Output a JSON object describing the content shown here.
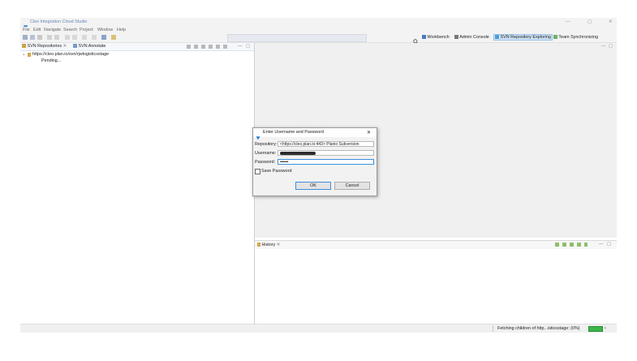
{
  "app": {
    "title": "Cleo Integration Cloud Studio",
    "window_controls": {
      "minimize": "—",
      "maximize": "▢",
      "close": "✕"
    }
  },
  "menu": [
    "File",
    "Edit",
    "Navigate",
    "Search",
    "Project",
    "Window",
    "Help"
  ],
  "toolbar": {
    "perspectives": {
      "workbench": "Workbench",
      "admin_console": "Admin Console",
      "svn_exploring": "SVN Repository Exploring",
      "team_sync": "Team Synchronizing"
    }
  },
  "left_panel": {
    "tabs": [
      {
        "label": "SVN Repositories",
        "close": "✕"
      },
      {
        "label": "SVN Annotate"
      }
    ],
    "tree": {
      "root": "https://cleo.plan.io/svn/rjwlogisticsstage",
      "child": "Pending..."
    }
  },
  "history_panel": {
    "tab": "History",
    "close": "✕"
  },
  "status": {
    "text": "Fetching children of http...isticsstage: (0%)",
    "progress": 0.0
  },
  "dialog": {
    "title": "Enter Username and Password",
    "close": "✕",
    "repository_label": "Repository:",
    "repository_value": "<https://cleo.plan.io:443> Planio Subversion",
    "username_label": "Username:",
    "password_label": "Password:",
    "password_value": "••••••••",
    "save_password_label": "Save Password",
    "save_password_checked": false,
    "ok": "OK",
    "cancel": "Cancel"
  },
  "colors": {
    "accent": "#1f78d1",
    "perspective_active": "#cfe3f7",
    "progress": "#3db54a"
  }
}
